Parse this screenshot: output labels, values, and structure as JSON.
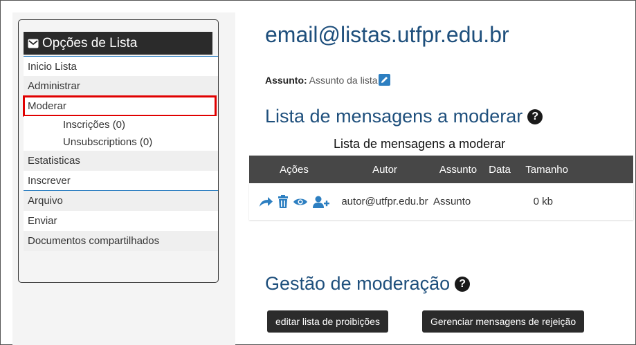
{
  "sidebar": {
    "header": "Opções de Lista",
    "items": [
      {
        "label": "Inicio Lista"
      },
      {
        "label": "Administrar"
      },
      {
        "label": "Moderar"
      },
      {
        "label": "Inscrições (0)"
      },
      {
        "label": "Unsubscriptions (0)"
      },
      {
        "label": "Estatisticas"
      },
      {
        "label": "Inscrever"
      },
      {
        "label": "Arquivo"
      },
      {
        "label": "Enviar"
      },
      {
        "label": "Documentos compartilhados"
      }
    ]
  },
  "main": {
    "title": "email@listas.utfpr.edu.br",
    "subject_label": "Assunto:",
    "subject_value": "Assunto da lista",
    "section1_title": "Lista de mensagens a moderar",
    "table_caption": "Lista de mensagens a moderar",
    "table": {
      "headers": [
        "Ações",
        "Autor",
        "Assunto",
        "Data",
        "Tamanho"
      ],
      "rows": [
        {
          "author": "autor@utfpr.edu.br",
          "subject": "Assunto",
          "date": "",
          "size": "0 kb"
        }
      ]
    },
    "section2_title": "Gestão de moderação",
    "buttons": {
      "ban_list": "editar lista de proibições",
      "rejection": "Gerenciar mensagens de rejeição"
    }
  },
  "icons": {
    "envelope": "envelope-icon",
    "edit": "pencil-icon",
    "help": "question-circle-icon",
    "forward": "forward-arrow-icon",
    "delete": "trash-icon",
    "view": "eye-icon",
    "add_user": "user-plus-icon"
  },
  "colors": {
    "accent": "#2d7fc1",
    "title": "#1e4f7c",
    "highlight": "#e00000",
    "dark": "#2b2b2b"
  }
}
